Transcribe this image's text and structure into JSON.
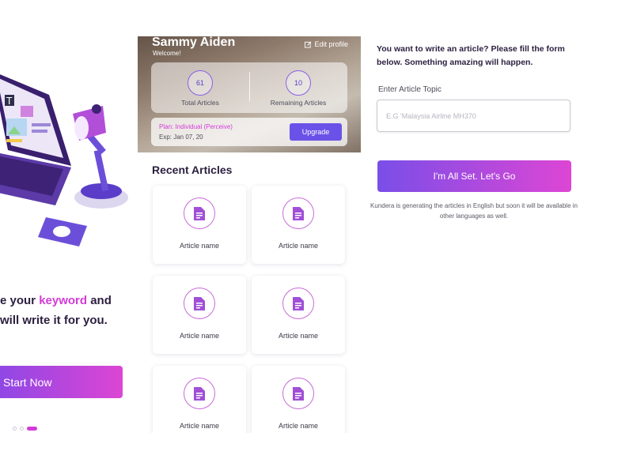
{
  "onboarding": {
    "tagline_line1_prefix": "e your ",
    "tagline_keyword": "keyword",
    "tagline_line1_suffix": " and",
    "tagline_line2": "will write it for you.",
    "start_button": "Start Now",
    "carousel": {
      "dot_count": 3,
      "active_index": 2
    }
  },
  "dashboard": {
    "user_name": "Sammy Aiden",
    "welcome": "Welcome!",
    "edit_profile": "Edit profile",
    "stats": {
      "total_articles": {
        "value": "61",
        "label": "Total Articles"
      },
      "remaining_articles": {
        "value": "10",
        "label": "Remaining Articles"
      }
    },
    "plan": {
      "text": "Plan: Individual (Perceive)",
      "expiry": "Exp: Jan 07, 20",
      "upgrade_button": "Upgrade"
    },
    "recent_title": "Recent Articles",
    "articles": [
      {
        "name": "Article name"
      },
      {
        "name": "Article name"
      },
      {
        "name": "Article name"
      },
      {
        "name": "Article name"
      },
      {
        "name": "Article name"
      },
      {
        "name": "Article name"
      }
    ]
  },
  "form": {
    "intro": "You want to write an article? Please fill the form below. Something amazing will happen.",
    "topic_label": "Enter Article Topic",
    "topic_placeholder": "E.G 'Malaysia Airline MH370",
    "topic_value": "",
    "submit_button": "I'm All Set. Let's Go",
    "note": "Kundera is generating the articles in English but soon it will be available in other languages as well."
  },
  "colors": {
    "accent_purple": "#6a52e8",
    "accent_pink": "#d43bd8",
    "gradient_start": "#7a4ee8",
    "gradient_end": "#dd46d4"
  },
  "icons": [
    "edit-icon",
    "document-icon"
  ]
}
